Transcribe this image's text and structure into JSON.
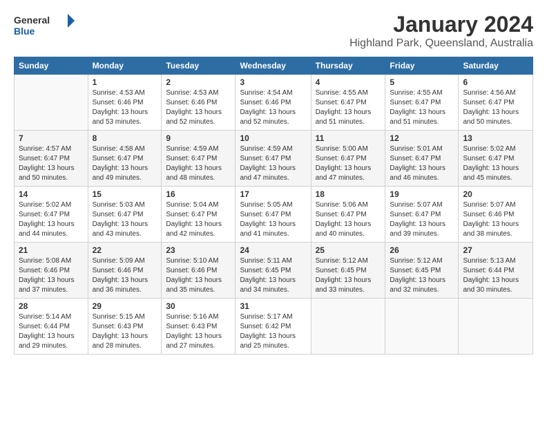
{
  "logo": {
    "general": "General",
    "blue": "Blue"
  },
  "title": "January 2024",
  "subtitle": "Highland Park, Queensland, Australia",
  "days_header": [
    "Sunday",
    "Monday",
    "Tuesday",
    "Wednesday",
    "Thursday",
    "Friday",
    "Saturday"
  ],
  "weeks": [
    [
      {
        "num": "",
        "info": ""
      },
      {
        "num": "1",
        "info": "Sunrise: 4:53 AM\nSunset: 6:46 PM\nDaylight: 13 hours\nand 53 minutes."
      },
      {
        "num": "2",
        "info": "Sunrise: 4:53 AM\nSunset: 6:46 PM\nDaylight: 13 hours\nand 52 minutes."
      },
      {
        "num": "3",
        "info": "Sunrise: 4:54 AM\nSunset: 6:46 PM\nDaylight: 13 hours\nand 52 minutes."
      },
      {
        "num": "4",
        "info": "Sunrise: 4:55 AM\nSunset: 6:47 PM\nDaylight: 13 hours\nand 51 minutes."
      },
      {
        "num": "5",
        "info": "Sunrise: 4:55 AM\nSunset: 6:47 PM\nDaylight: 13 hours\nand 51 minutes."
      },
      {
        "num": "6",
        "info": "Sunrise: 4:56 AM\nSunset: 6:47 PM\nDaylight: 13 hours\nand 50 minutes."
      }
    ],
    [
      {
        "num": "7",
        "info": "Sunrise: 4:57 AM\nSunset: 6:47 PM\nDaylight: 13 hours\nand 50 minutes."
      },
      {
        "num": "8",
        "info": "Sunrise: 4:58 AM\nSunset: 6:47 PM\nDaylight: 13 hours\nand 49 minutes."
      },
      {
        "num": "9",
        "info": "Sunrise: 4:59 AM\nSunset: 6:47 PM\nDaylight: 13 hours\nand 48 minutes."
      },
      {
        "num": "10",
        "info": "Sunrise: 4:59 AM\nSunset: 6:47 PM\nDaylight: 13 hours\nand 47 minutes."
      },
      {
        "num": "11",
        "info": "Sunrise: 5:00 AM\nSunset: 6:47 PM\nDaylight: 13 hours\nand 47 minutes."
      },
      {
        "num": "12",
        "info": "Sunrise: 5:01 AM\nSunset: 6:47 PM\nDaylight: 13 hours\nand 46 minutes."
      },
      {
        "num": "13",
        "info": "Sunrise: 5:02 AM\nSunset: 6:47 PM\nDaylight: 13 hours\nand 45 minutes."
      }
    ],
    [
      {
        "num": "14",
        "info": "Sunrise: 5:02 AM\nSunset: 6:47 PM\nDaylight: 13 hours\nand 44 minutes."
      },
      {
        "num": "15",
        "info": "Sunrise: 5:03 AM\nSunset: 6:47 PM\nDaylight: 13 hours\nand 43 minutes."
      },
      {
        "num": "16",
        "info": "Sunrise: 5:04 AM\nSunset: 6:47 PM\nDaylight: 13 hours\nand 42 minutes."
      },
      {
        "num": "17",
        "info": "Sunrise: 5:05 AM\nSunset: 6:47 PM\nDaylight: 13 hours\nand 41 minutes."
      },
      {
        "num": "18",
        "info": "Sunrise: 5:06 AM\nSunset: 6:47 PM\nDaylight: 13 hours\nand 40 minutes."
      },
      {
        "num": "19",
        "info": "Sunrise: 5:07 AM\nSunset: 6:47 PM\nDaylight: 13 hours\nand 39 minutes."
      },
      {
        "num": "20",
        "info": "Sunrise: 5:07 AM\nSunset: 6:46 PM\nDaylight: 13 hours\nand 38 minutes."
      }
    ],
    [
      {
        "num": "21",
        "info": "Sunrise: 5:08 AM\nSunset: 6:46 PM\nDaylight: 13 hours\nand 37 minutes."
      },
      {
        "num": "22",
        "info": "Sunrise: 5:09 AM\nSunset: 6:46 PM\nDaylight: 13 hours\nand 36 minutes."
      },
      {
        "num": "23",
        "info": "Sunrise: 5:10 AM\nSunset: 6:46 PM\nDaylight: 13 hours\nand 35 minutes."
      },
      {
        "num": "24",
        "info": "Sunrise: 5:11 AM\nSunset: 6:45 PM\nDaylight: 13 hours\nand 34 minutes."
      },
      {
        "num": "25",
        "info": "Sunrise: 5:12 AM\nSunset: 6:45 PM\nDaylight: 13 hours\nand 33 minutes."
      },
      {
        "num": "26",
        "info": "Sunrise: 5:12 AM\nSunset: 6:45 PM\nDaylight: 13 hours\nand 32 minutes."
      },
      {
        "num": "27",
        "info": "Sunrise: 5:13 AM\nSunset: 6:44 PM\nDaylight: 13 hours\nand 30 minutes."
      }
    ],
    [
      {
        "num": "28",
        "info": "Sunrise: 5:14 AM\nSunset: 6:44 PM\nDaylight: 13 hours\nand 29 minutes."
      },
      {
        "num": "29",
        "info": "Sunrise: 5:15 AM\nSunset: 6:43 PM\nDaylight: 13 hours\nand 28 minutes."
      },
      {
        "num": "30",
        "info": "Sunrise: 5:16 AM\nSunset: 6:43 PM\nDaylight: 13 hours\nand 27 minutes."
      },
      {
        "num": "31",
        "info": "Sunrise: 5:17 AM\nSunset: 6:42 PM\nDaylight: 13 hours\nand 25 minutes."
      },
      {
        "num": "",
        "info": ""
      },
      {
        "num": "",
        "info": ""
      },
      {
        "num": "",
        "info": ""
      }
    ]
  ]
}
